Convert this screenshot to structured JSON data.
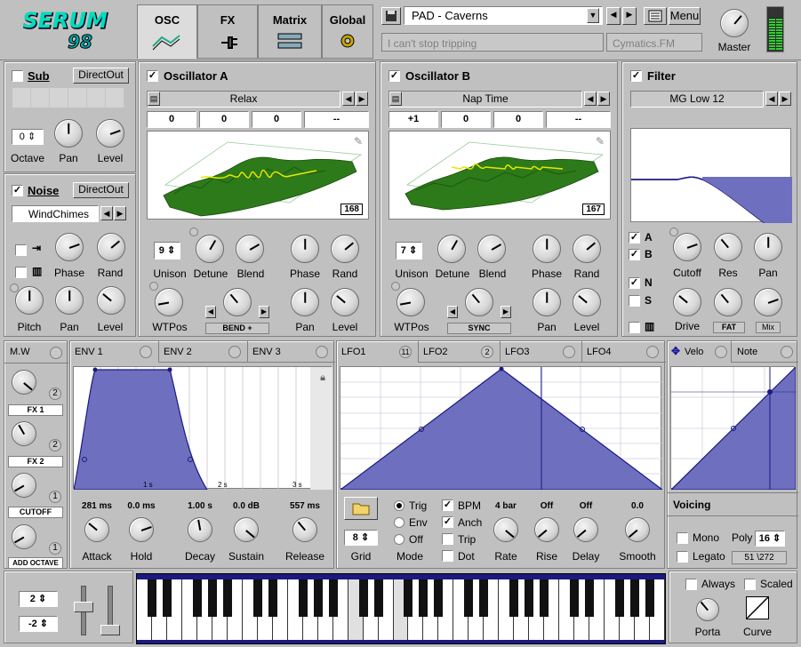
{
  "brand": {
    "logo_top": "SERUM",
    "logo_bottom": "98"
  },
  "tabs": [
    {
      "label": "OSC",
      "icon": "oscillator-icon"
    },
    {
      "label": "FX",
      "icon": "plug-icon"
    },
    {
      "label": "Matrix",
      "icon": "matrix-icon"
    },
    {
      "label": "Global",
      "icon": "gear-icon"
    }
  ],
  "preset": {
    "name": "PAD - Caverns",
    "description": "I can't stop tripping",
    "author": "Cymatics.FM",
    "menu_label": "Menu",
    "master_label": "Master"
  },
  "sub": {
    "title": "Sub",
    "directout": "DirectOut",
    "octave_value": "0",
    "knobs": [
      "Octave",
      "Pan",
      "Level"
    ]
  },
  "noise": {
    "title": "Noise",
    "directout": "DirectOut",
    "source": "WindChimes",
    "row1": [
      "Phase",
      "Rand"
    ],
    "row2": [
      "Pitch",
      "Pan",
      "Level"
    ]
  },
  "osc_a": {
    "title": "Oscillator A",
    "wavetable": "Relax",
    "fields": [
      "0",
      "0",
      "0",
      "--"
    ],
    "frame": "168",
    "unison": "9",
    "labels_row1": [
      "Unison",
      "Detune",
      "Blend",
      "Phase",
      "Rand"
    ],
    "labels_row2": [
      "WTPos",
      "Pan",
      "Level"
    ],
    "warp": "BEND +"
  },
  "osc_b": {
    "title": "Oscillator B",
    "wavetable": "Nap Time",
    "fields": [
      "+1",
      "0",
      "0",
      "--"
    ],
    "frame": "167",
    "unison": "7",
    "labels_row1": [
      "Unison",
      "Detune",
      "Blend",
      "Phase",
      "Rand"
    ],
    "labels_row2": [
      "WTPos",
      "Pan",
      "Level"
    ],
    "warp": "SYNC"
  },
  "filter": {
    "title": "Filter",
    "type": "MG Low 12",
    "routes": [
      "A",
      "B",
      "N",
      "S"
    ],
    "knobs_row1": [
      "Cutoff",
      "Res",
      "Pan"
    ],
    "knobs_row2": [
      "Drive",
      "FAT",
      "Mix"
    ]
  },
  "macros": {
    "mw_label": "M.W",
    "items": [
      {
        "label": "FX 1",
        "count": "2"
      },
      {
        "label": "FX 2",
        "count": "2"
      },
      {
        "label": "CUTOFF",
        "count": "1"
      },
      {
        "label": "ADD OCTAVE",
        "count": "1"
      }
    ]
  },
  "env": {
    "tabs": [
      "ENV 1",
      "ENV 2",
      "ENV 3"
    ],
    "grid_marks": [
      "1 s",
      "2 s",
      "3 s"
    ],
    "params": [
      {
        "label": "Attack",
        "value": "281 ms"
      },
      {
        "label": "Hold",
        "value": "0.0 ms"
      },
      {
        "label": "Decay",
        "value": "1.00 s"
      },
      {
        "label": "Sustain",
        "value": "0.0 dB"
      },
      {
        "label": "Release",
        "value": "557 ms"
      }
    ]
  },
  "lfo": {
    "tabs": [
      {
        "label": "LFO1",
        "count": "11"
      },
      {
        "label": "LFO2",
        "count": "2"
      },
      {
        "label": "LFO3",
        "count": ""
      },
      {
        "label": "LFO4",
        "count": ""
      }
    ],
    "grid_value": "8",
    "grid_label": "Grid",
    "modes": [
      "Trig",
      "Env",
      "Off"
    ],
    "mode_label": "Mode",
    "options": [
      "BPM",
      "Anch",
      "Trip",
      "Dot"
    ],
    "params": [
      {
        "label": "Rate",
        "value": "4 bar"
      },
      {
        "label": "Rise",
        "value": "Off"
      },
      {
        "label": "Delay",
        "value": "Off"
      },
      {
        "label": "Smooth",
        "value": "0.0"
      }
    ]
  },
  "velo": {
    "tabs": [
      "Velo",
      "Note"
    ],
    "voicing_title": "Voicing",
    "mono": "Mono",
    "legato": "Legato",
    "poly_label": "Poly",
    "poly_value": "16",
    "voices": "51 \\272"
  },
  "keyboard": {
    "pitch_up": "2",
    "pitch_down": "-2",
    "always": "Always",
    "scaled": "Scaled",
    "porta": "Porta",
    "curve": "Curve"
  },
  "colors": {
    "accent": "#6f6fbf",
    "window_bg": "#c0c0c0",
    "wave_green": "#2d7a1a",
    "wave_yellow": "#e8e800"
  }
}
